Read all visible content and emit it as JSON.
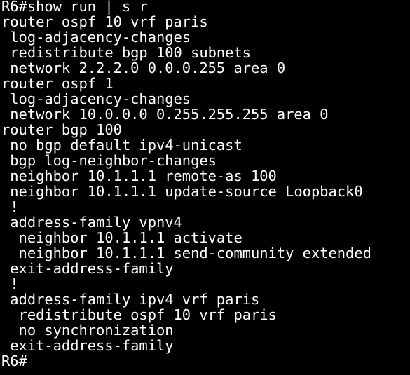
{
  "terminal": {
    "background": "#000000",
    "foreground": "#ffffff",
    "lines": [
      "R6#show run | s r",
      "router ospf 10 vrf paris",
      " log-adjacency-changes",
      " redistribute bgp 100 subnets",
      " network 2.2.2.0 0.0.0.255 area 0",
      "router ospf 1",
      " log-adjacency-changes",
      " network 10.0.0.0 0.255.255.255 area 0",
      "router bgp 100",
      " no bgp default ipv4-unicast",
      " bgp log-neighbor-changes",
      " neighbor 10.1.1.1 remote-as 100",
      " neighbor 10.1.1.1 update-source Loopback0",
      " !",
      " address-family vpnv4",
      "  neighbor 10.1.1.1 activate",
      "  neighbor 10.1.1.1 send-community extended",
      " exit-address-family",
      " !",
      " address-family ipv4 vrf paris",
      "  redistribute ospf 10 vrf paris",
      "  no synchronization",
      " exit-address-family",
      "R6#"
    ]
  }
}
